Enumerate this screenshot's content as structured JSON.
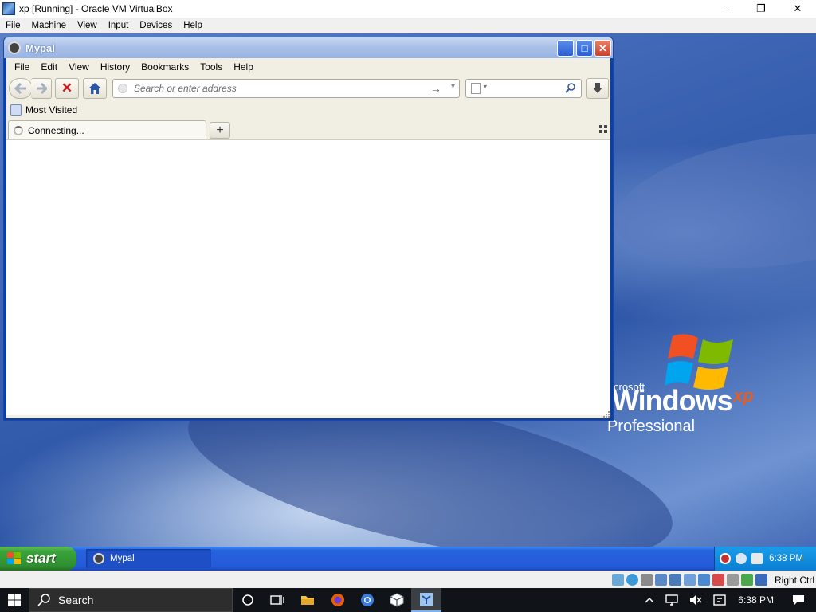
{
  "host_window": {
    "title": "xp [Running] - Oracle VM VirtualBox",
    "controls": {
      "minimize": "–",
      "restore": "❐",
      "close": "✕"
    },
    "menu": [
      "File",
      "Machine",
      "View",
      "Input",
      "Devices",
      "Help"
    ]
  },
  "desktop_logo": {
    "brand_prefix": "crosoft",
    "brand": "Windows",
    "version": "xp",
    "edition": "Professional"
  },
  "browser": {
    "title": "Mypal",
    "controls": {
      "minimize": "_",
      "maximize": "□",
      "close": "✕"
    },
    "menu": [
      "File",
      "Edit",
      "View",
      "History",
      "Bookmarks",
      "Tools",
      "Help"
    ],
    "address_placeholder": "Search or enter address",
    "go_glyph": "→",
    "dropdown_glyph": "▾",
    "stop_glyph": "✕",
    "bookmarks_toolbar": {
      "item": "Most Visited"
    },
    "tabs": [
      {
        "label": "Connecting..."
      }
    ],
    "new_tab_glyph": "+"
  },
  "guest_taskbar": {
    "start_label": "start",
    "tasks": [
      {
        "label": "Mypal"
      }
    ],
    "clock": "6:38 PM"
  },
  "vbox_status": {
    "host_key": "Right Ctrl"
  },
  "host_taskbar": {
    "search_label": "Search",
    "clock": "6:38 PM"
  },
  "colors": {
    "xp_blue": "#2559d8",
    "xp_green": "#3aa33a",
    "stop_red": "#c81818",
    "host_dark": "#101418"
  }
}
